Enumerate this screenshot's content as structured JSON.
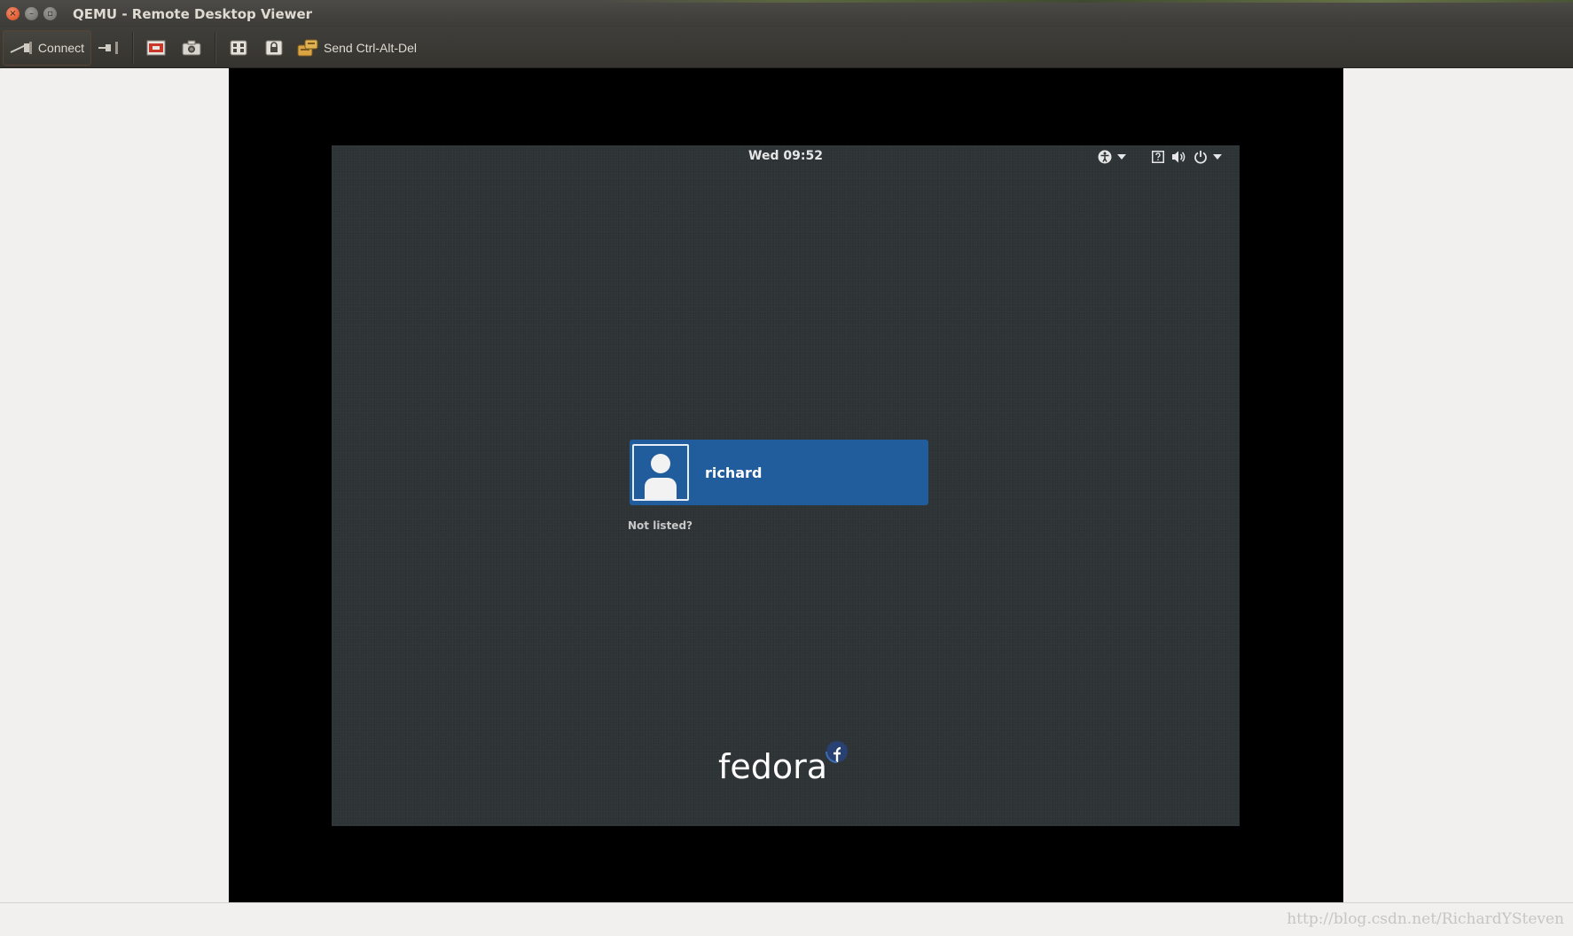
{
  "window": {
    "title": "QEMU - Remote Desktop Viewer",
    "close_glyph": "×",
    "min_glyph": "–",
    "max_glyph": "▫"
  },
  "toolbar": {
    "connect_label": "Connect",
    "send_cad_label": "Send Ctrl-Alt-Del",
    "icons": [
      "connect-icon",
      "disconnect-icon",
      "fullscreen-icon",
      "screenshot-icon",
      "keyboard-icon",
      "lock-icon",
      "send-keys-icon"
    ]
  },
  "remote": {
    "clock": "Wed 09:52",
    "user": {
      "name": "richard"
    },
    "not_listed": "Not listed?",
    "logo_text": "fedora",
    "indicators": [
      "accessibility-icon",
      "chevron-down-icon",
      "keyboard-layout-icon",
      "volume-icon",
      "power-icon",
      "chevron-down-icon"
    ]
  },
  "statusbar": {
    "watermark": "http://blog.csdn.net/RichardYSteven"
  },
  "colors": {
    "titlebar": "#3c3b37",
    "remote_bg": "#2e3436",
    "user_card": "#215d9c",
    "fedora_blue": "#294172"
  }
}
